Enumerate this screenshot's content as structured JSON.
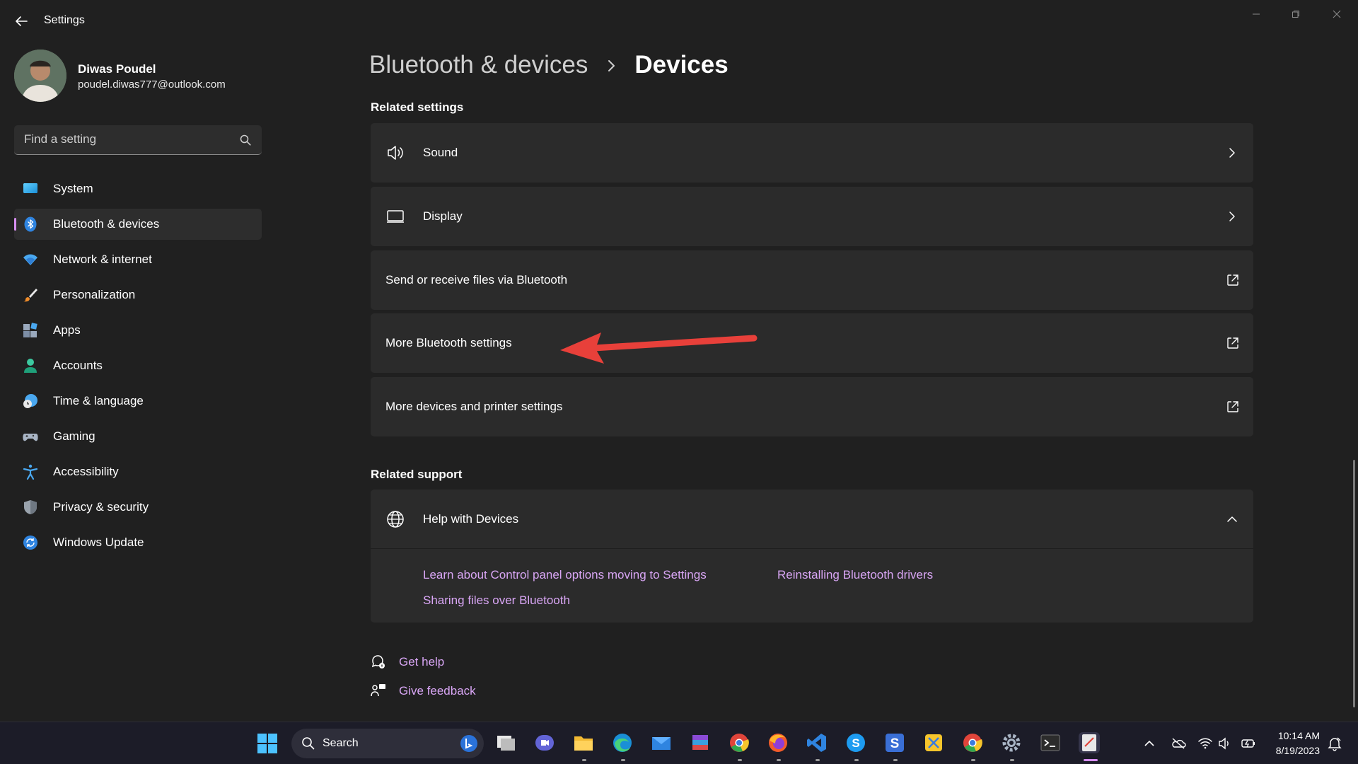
{
  "window": {
    "title": "Settings"
  },
  "user": {
    "name": "Diwas Poudel",
    "email": "poudel.diwas777@outlook.com"
  },
  "search": {
    "placeholder": "Find a setting"
  },
  "sidebar": {
    "items": [
      {
        "label": "System",
        "icon": "system-icon",
        "active": false
      },
      {
        "label": "Bluetooth & devices",
        "icon": "bluetooth-icon",
        "active": true
      },
      {
        "label": "Network & internet",
        "icon": "wifi-icon",
        "active": false
      },
      {
        "label": "Personalization",
        "icon": "brush-icon",
        "active": false
      },
      {
        "label": "Apps",
        "icon": "apps-icon",
        "active": false
      },
      {
        "label": "Accounts",
        "icon": "person-icon",
        "active": false
      },
      {
        "label": "Time & language",
        "icon": "clock-globe-icon",
        "active": false
      },
      {
        "label": "Gaming",
        "icon": "gamepad-icon",
        "active": false
      },
      {
        "label": "Accessibility",
        "icon": "accessibility-icon",
        "active": false
      },
      {
        "label": "Privacy & security",
        "icon": "shield-icon",
        "active": false
      },
      {
        "label": "Windows Update",
        "icon": "update-icon",
        "active": false
      }
    ]
  },
  "breadcrumb": {
    "parent": "Bluetooth & devices",
    "current": "Devices"
  },
  "related_settings": {
    "title": "Related settings",
    "items": [
      {
        "label": "Sound",
        "icon": "speaker-icon",
        "trailing": "chevron-right-icon"
      },
      {
        "label": "Display",
        "icon": "monitor-icon",
        "trailing": "chevron-right-icon"
      },
      {
        "label": "Send or receive files via Bluetooth",
        "icon": "",
        "trailing": "external-link-icon"
      },
      {
        "label": "More Bluetooth settings",
        "icon": "",
        "trailing": "external-link-icon"
      },
      {
        "label": "More devices and printer settings",
        "icon": "",
        "trailing": "external-link-icon"
      }
    ]
  },
  "related_support": {
    "title": "Related support",
    "help_title": "Help with Devices",
    "links": [
      "Learn about Control panel options moving to Settings",
      "Reinstalling Bluetooth drivers",
      "Sharing files over Bluetooth"
    ]
  },
  "footer_links": {
    "get_help": "Get help",
    "give_feedback": "Give feedback"
  },
  "taskbar": {
    "search_label": "Search",
    "time": "10:14 AM",
    "date": "8/19/2023"
  },
  "colors": {
    "background": "#202020",
    "card": "#2b2b2b",
    "accent": "#d68ef0",
    "link": "#d9a6f5",
    "annotation": "#e8403a"
  }
}
